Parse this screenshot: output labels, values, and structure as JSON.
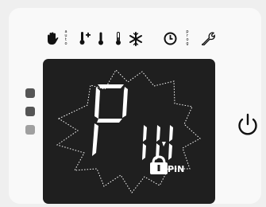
{
  "panel": {
    "mode_icons": [
      {
        "name": "manual-hand-icon"
      },
      {
        "name": "auto-mode-icon",
        "text": "auto"
      },
      {
        "name": "comfort-plus-thermometer-icon"
      },
      {
        "name": "eco-thermometer-icon"
      },
      {
        "name": "low-thermometer-icon"
      },
      {
        "name": "frost-snowflake-icon"
      }
    ],
    "right_icons": [
      {
        "name": "clock-icon"
      },
      {
        "name": "program-icon",
        "text": "prog"
      },
      {
        "name": "wrench-settings-icon"
      }
    ],
    "leds": [
      {
        "name": "led-1",
        "color": "#555555"
      },
      {
        "name": "led-2",
        "color": "#555555"
      },
      {
        "name": "led-3",
        "color": "#a0a0a0"
      }
    ],
    "display": {
      "big_letter": "P",
      "small_text": "IN",
      "pin_label": "PIN",
      "background": "#1f1f1f",
      "segment_color": "#ffffff"
    },
    "power_button": {
      "icon": "power-icon"
    }
  }
}
